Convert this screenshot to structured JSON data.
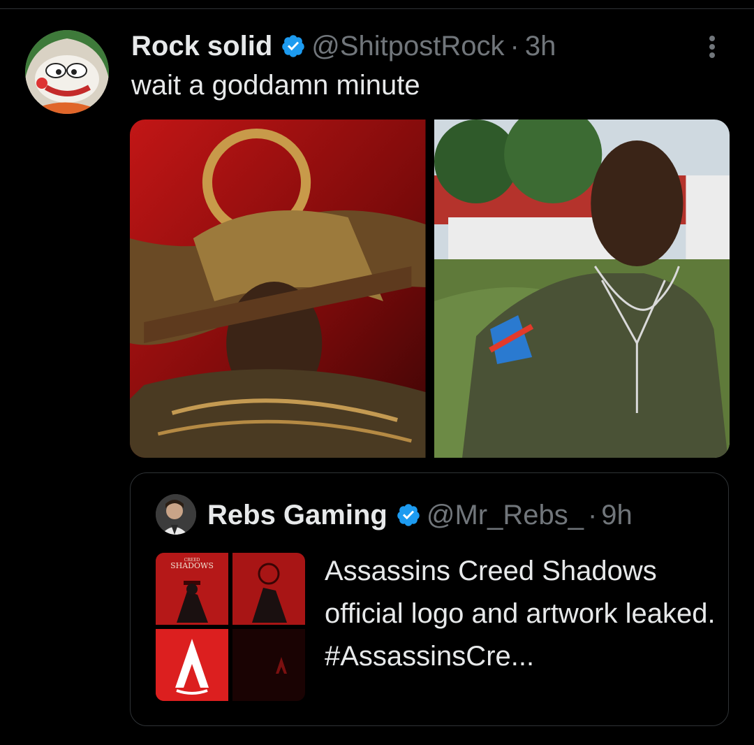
{
  "tweet": {
    "author_name": "Rock solid",
    "handle": "@ShitpostRock",
    "separator": "·",
    "time": "3h",
    "text": "wait a goddamn minute"
  },
  "quoted": {
    "author_name": "Rebs Gaming",
    "handle": "@Mr_Rebs_",
    "separator": "·",
    "time": "9h",
    "text": "Assassins Creed Shadows official logo and artwork leaked. #AssassinsCre...",
    "thumb_caption_small": "CREED",
    "thumb_caption": "SHADOWS"
  },
  "colors": {
    "background": "#000000",
    "text": "#e7e9ea",
    "secondary": "#71767b",
    "verified": "#1d9bf0",
    "border": "#2f3336"
  },
  "icons": {
    "verified": "verified-badge-icon",
    "more": "more-options-icon"
  }
}
